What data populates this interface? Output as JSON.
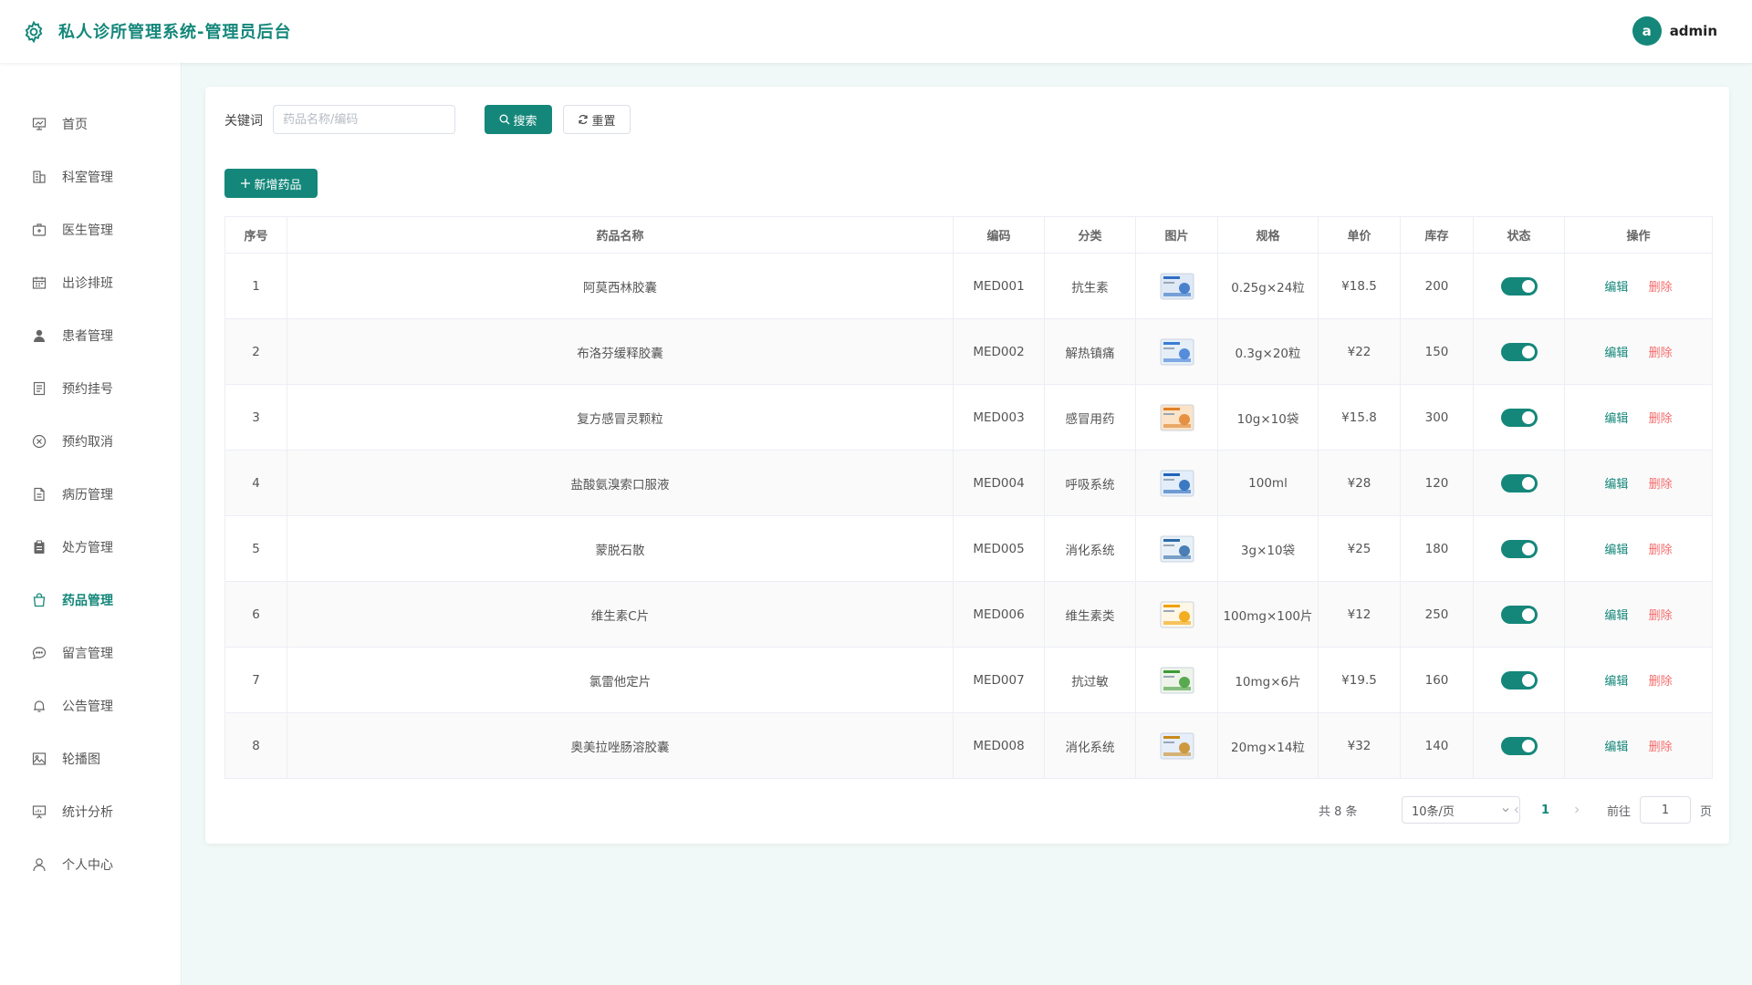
{
  "header": {
    "title": "私人诊所管理系统-管理员后台",
    "avatar_letter": "a",
    "username": "admin"
  },
  "sidebar": {
    "items": [
      {
        "label": "首页",
        "icon": "monitor-chart-icon",
        "active": false
      },
      {
        "label": "科室管理",
        "icon": "building-icon",
        "active": false
      },
      {
        "label": "医生管理",
        "icon": "first-aid-kit-icon",
        "active": false
      },
      {
        "label": "出诊排班",
        "icon": "calendar-icon",
        "active": false
      },
      {
        "label": "患者管理",
        "icon": "user-filled-icon",
        "active": false
      },
      {
        "label": "预约挂号",
        "icon": "document-list-icon",
        "active": false
      },
      {
        "label": "预约取消",
        "icon": "circle-close-icon",
        "active": false
      },
      {
        "label": "病历管理",
        "icon": "document-icon",
        "active": false
      },
      {
        "label": "处方管理",
        "icon": "clipboard-icon",
        "active": false
      },
      {
        "label": "药品管理",
        "icon": "shopping-bag-icon",
        "active": true
      },
      {
        "label": "留言管理",
        "icon": "chat-bubble-icon",
        "active": false
      },
      {
        "label": "公告管理",
        "icon": "bell-icon",
        "active": false
      },
      {
        "label": "轮播图",
        "icon": "picture-icon",
        "active": false
      },
      {
        "label": "统计分析",
        "icon": "presentation-icon",
        "active": false
      },
      {
        "label": "个人中心",
        "icon": "user-outline-icon",
        "active": false
      }
    ]
  },
  "search": {
    "label": "关键词",
    "placeholder": "药品名称/编码",
    "value": "",
    "search_button": "搜索",
    "reset_button": "重置"
  },
  "toolbar": {
    "add_button": "新增药品"
  },
  "table": {
    "columns": [
      "序号",
      "药品名称",
      "编码",
      "分类",
      "图片",
      "规格",
      "单价",
      "库存",
      "状态",
      "操作"
    ],
    "edit_label": "编辑",
    "delete_label": "删除",
    "rows": [
      {
        "index": "1",
        "name": "阿莫西林胶囊",
        "code": "MED001",
        "category": "抗生素",
        "spec": "0.25g×24粒",
        "price": "¥18.5",
        "stock": "200",
        "status": true
      },
      {
        "index": "2",
        "name": "布洛芬缓释胶囊",
        "code": "MED002",
        "category": "解热镇痛",
        "spec": "0.3g×20粒",
        "price": "¥22",
        "stock": "150",
        "status": true
      },
      {
        "index": "3",
        "name": "复方感冒灵颗粒",
        "code": "MED003",
        "category": "感冒用药",
        "spec": "10g×10袋",
        "price": "¥15.8",
        "stock": "300",
        "status": true
      },
      {
        "index": "4",
        "name": "盐酸氨溴索口服液",
        "code": "MED004",
        "category": "呼吸系统",
        "spec": "100ml",
        "price": "¥28",
        "stock": "120",
        "status": true
      },
      {
        "index": "5",
        "name": "蒙脱石散",
        "code": "MED005",
        "category": "消化系统",
        "spec": "3g×10袋",
        "price": "¥25",
        "stock": "180",
        "status": true
      },
      {
        "index": "6",
        "name": "维生素C片",
        "code": "MED006",
        "category": "维生素类",
        "spec": "100mg×100片",
        "price": "¥12",
        "stock": "250",
        "status": true
      },
      {
        "index": "7",
        "name": "氯雷他定片",
        "code": "MED007",
        "category": "抗过敏",
        "spec": "10mg×6片",
        "price": "¥19.5",
        "stock": "160",
        "status": true
      },
      {
        "index": "8",
        "name": "奥美拉唑肠溶胶囊",
        "code": "MED008",
        "category": "消化系统",
        "spec": "20mg×14粒",
        "price": "¥32",
        "stock": "140",
        "status": true
      }
    ]
  },
  "pagination": {
    "total_text": "共 8 条",
    "page_size": "10条/页",
    "current_page": "1",
    "goto_label": "前往",
    "goto_value": "1",
    "page_unit": "页"
  },
  "colors": {
    "primary": "#14877a",
    "danger": "#f56c6c",
    "background": "#f0f9f7"
  }
}
